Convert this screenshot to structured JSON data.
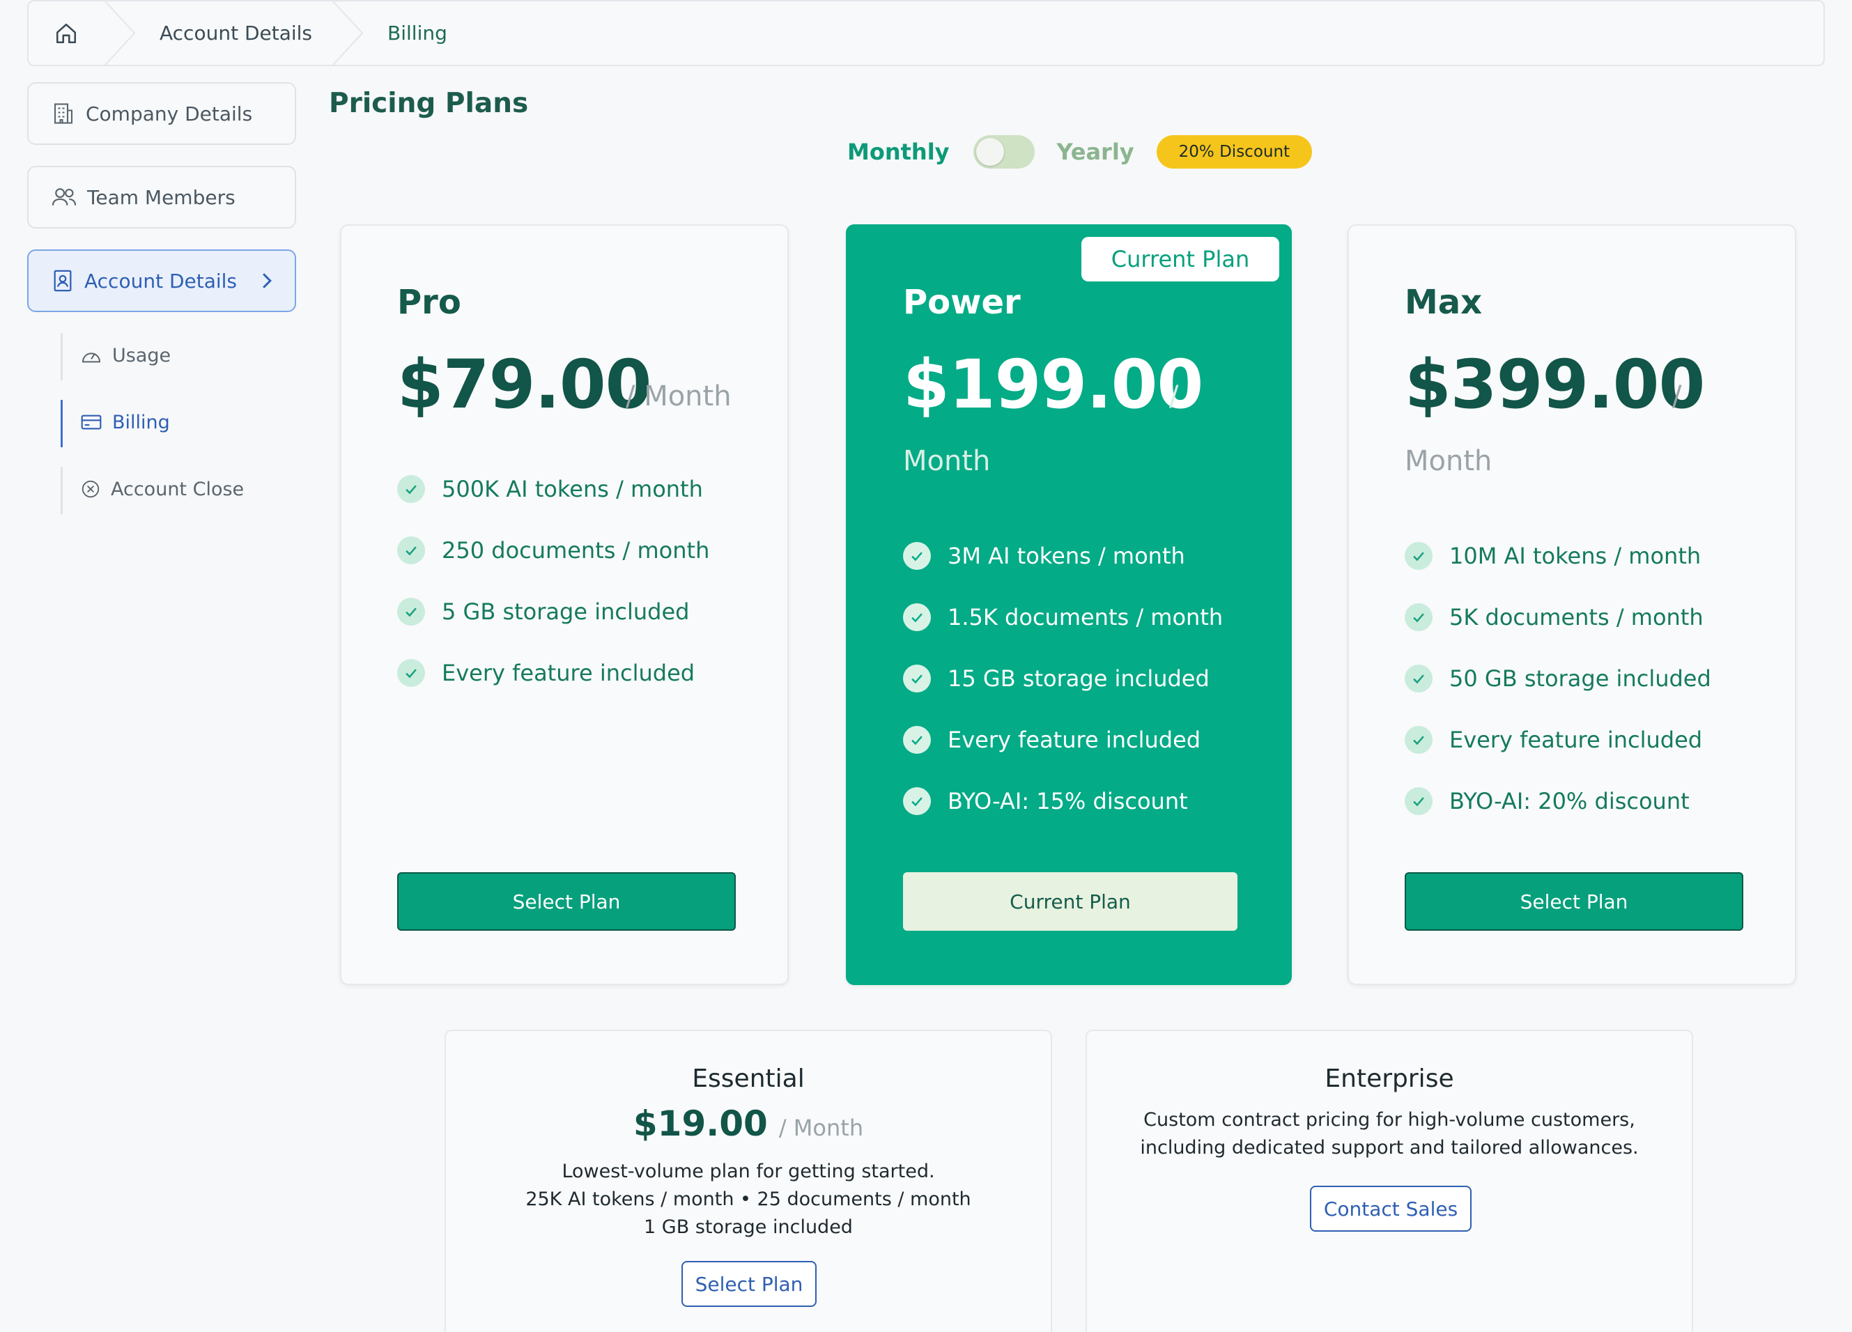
{
  "breadcrumb": {
    "items": [
      {
        "label": "Account Details"
      },
      {
        "label": "Billing"
      }
    ]
  },
  "sidebar": {
    "items": [
      {
        "label": "Company Details",
        "icon": "building-icon"
      },
      {
        "label": "Team Members",
        "icon": "users-icon"
      },
      {
        "label": "Account Details",
        "icon": "id-badge-icon"
      }
    ],
    "subitems": [
      {
        "label": "Usage",
        "icon": "gauge-icon"
      },
      {
        "label": "Billing",
        "icon": "credit-card-icon"
      },
      {
        "label": "Account Close",
        "icon": "circle-x-icon"
      }
    ]
  },
  "main": {
    "title": "Pricing Plans",
    "billing_toggle": {
      "monthly_label": "Monthly",
      "yearly_label": "Yearly",
      "discount_badge": "20% Discount",
      "selected": "Monthly"
    },
    "plans": [
      {
        "name": "Pro",
        "price": "$79.00",
        "per": "/ Month",
        "features": [
          "500K AI tokens / month",
          "250 documents / month",
          "5 GB storage included",
          "Every feature included"
        ],
        "button": "Select Plan"
      },
      {
        "name": "Power",
        "price": "$199.00",
        "per_slash": "/",
        "per_month": "Month",
        "tag": "Current Plan",
        "features": [
          "3M AI tokens / month",
          "1.5K documents / month",
          "15 GB storage included",
          "Every feature included",
          "BYO-AI: 15% discount"
        ],
        "button": "Current Plan"
      },
      {
        "name": "Max",
        "price": "$399.00",
        "per_slash": "/",
        "per_month": "Month",
        "features": [
          "10M AI tokens / month",
          "5K documents / month",
          "50 GB storage included",
          "Every feature included",
          "BYO-AI: 20% discount"
        ],
        "button": "Select Plan"
      }
    ],
    "essential": {
      "name": "Essential",
      "price": "$19.00",
      "per": "/ Month",
      "lines": [
        "Lowest-volume plan for getting started.",
        "25K AI tokens / month • 25 documents / month",
        "1 GB storage included"
      ],
      "button": "Select Plan"
    },
    "enterprise": {
      "name": "Enterprise",
      "lines": [
        "Custom contract pricing for high-volume customers,",
        "including dedicated support and tailored allowances."
      ],
      "button": "Contact Sales"
    }
  },
  "colors": {
    "brand_green": "#03ab86",
    "dark_green": "#125549",
    "link_blue": "#2f5fb3",
    "badge_yellow": "#f5c51c"
  }
}
